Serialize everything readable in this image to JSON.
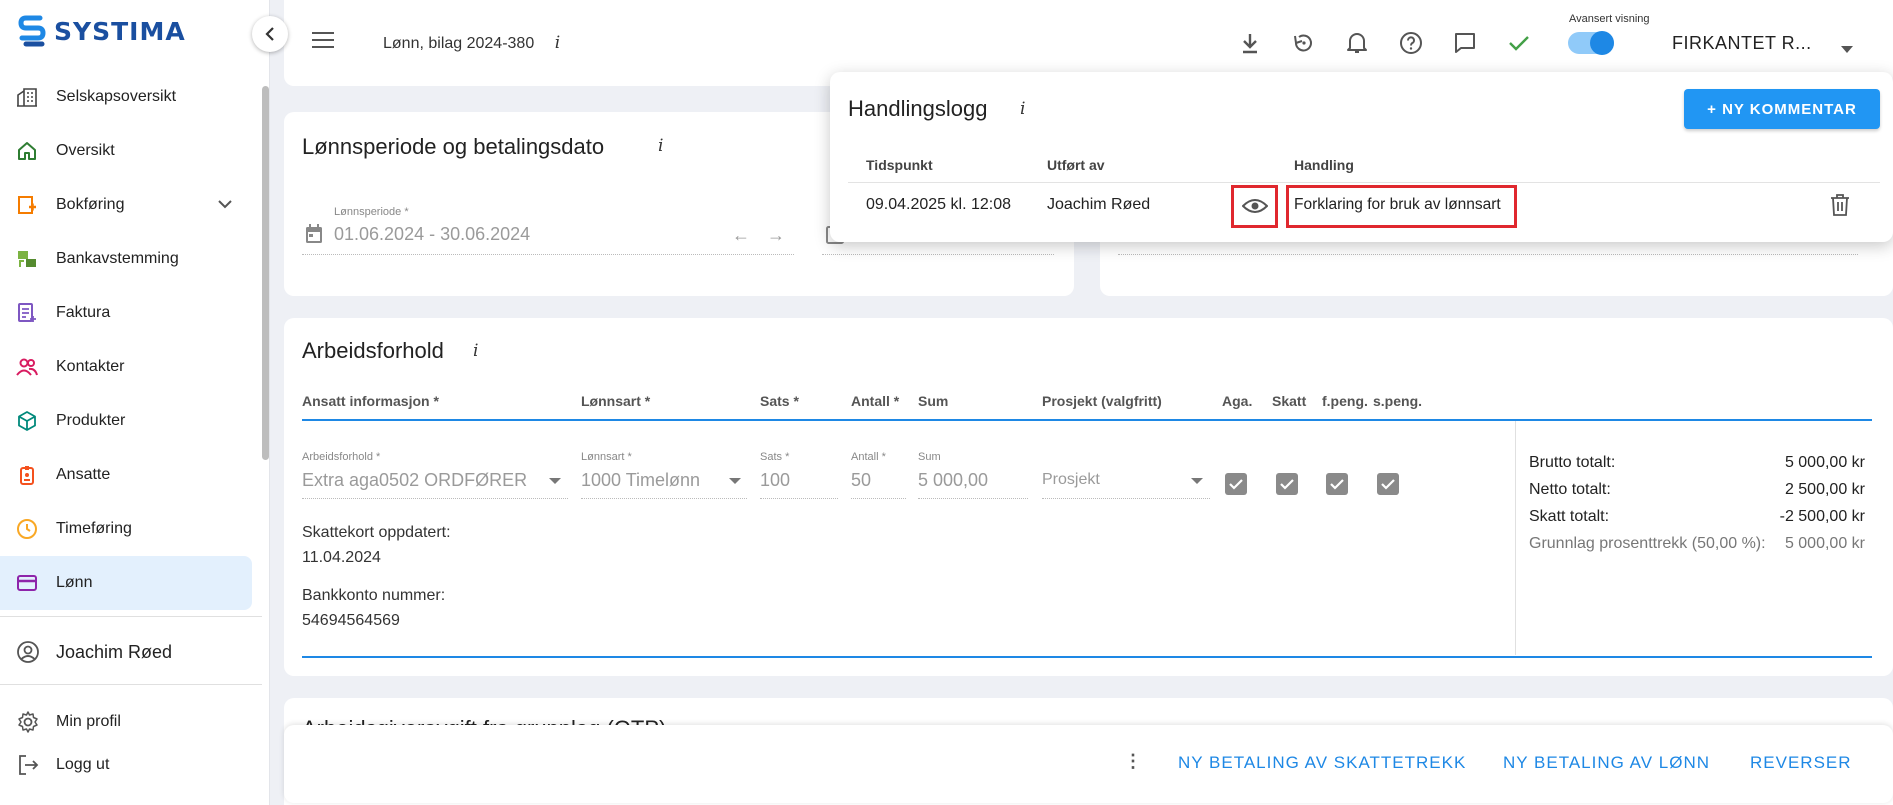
{
  "app": {
    "logo": "SYSTIMA",
    "brand_color": "#1a4fa0",
    "accent": "#1e88e5"
  },
  "sidebar": {
    "items": [
      {
        "label": "Selskapsoversikt",
        "icon": "building-icon"
      },
      {
        "label": "Oversikt",
        "icon": "home-icon"
      },
      {
        "label": "Bokføring",
        "icon": "ledger-icon",
        "has_children": true
      },
      {
        "label": "Bankavstemming",
        "icon": "bank-icon"
      },
      {
        "label": "Faktura",
        "icon": "invoice-icon"
      },
      {
        "label": "Kontakter",
        "icon": "contacts-icon"
      },
      {
        "label": "Produkter",
        "icon": "box-icon"
      },
      {
        "label": "Ansatte",
        "icon": "badge-icon"
      },
      {
        "label": "Timeføring",
        "icon": "clock-icon"
      },
      {
        "label": "Lønn",
        "icon": "card-icon",
        "active": true
      }
    ],
    "user": "Joachim Røed",
    "profile": "Min profil",
    "logout": "Logg ut"
  },
  "topbar": {
    "title": "Lønn, bilag 2024-380",
    "info": "i",
    "advanced_label": "Avansert visning",
    "advanced_on": true,
    "company": "FIRKANTET R..."
  },
  "period_card": {
    "title": "Lønnsperiode og betalingsdato",
    "info": "i",
    "period_label": "Lønnsperiode *",
    "period_value": "01.06.2024 - 30.06.2024"
  },
  "handlingslogg": {
    "title": "Handlingslogg",
    "info": "i",
    "new_comment": "+ NY KOMMENTAR",
    "columns": [
      "Tidspunkt",
      "Utført av",
      "Handling"
    ],
    "rows": [
      {
        "time": "09.04.2025 kl. 12:08",
        "by": "Joachim Røed",
        "action": "Forklaring for bruk av lønnsart"
      }
    ]
  },
  "arbeid": {
    "title": "Arbeidsforhold",
    "info": "i",
    "headers": [
      "Ansatt informasjon *",
      "Lønnsart *",
      "Sats *",
      "Antall *",
      "Sum",
      "Prosjekt (valgfritt)",
      "Aga.",
      "Skatt",
      "f.peng.",
      "s.peng."
    ],
    "fields": {
      "arbeidsforhold_label": "Arbeidsforhold *",
      "arbeidsforhold_value": "Extra aga0502 ORDFØRER",
      "lonnsart_label": "Lønnsart *",
      "lonnsart_value": "1000 Timelønn",
      "sats_label": "Sats *",
      "sats_value": "100",
      "antall_label": "Antall *",
      "antall_value": "50",
      "sum_label": "Sum",
      "sum_value": "5 000,00",
      "prosjekt_placeholder": "Prosjekt"
    },
    "checks": {
      "aga": true,
      "skatt": true,
      "fpeng": true,
      "speng": true
    },
    "skattekort_label": "Skattekort oppdatert:",
    "skattekort_date": "11.04.2024",
    "bank_label": "Bankkonto nummer:",
    "bank_number": "54694564569",
    "totals": [
      {
        "label": "Brutto totalt:",
        "value": "5 000,00 kr"
      },
      {
        "label": "Netto totalt:",
        "value": "2 500,00 kr"
      },
      {
        "label": "Skatt totalt:",
        "value": "-2 500,00 kr"
      },
      {
        "label": "Grunnlag prosenttrekk (50,00 %):",
        "value": "5 000,00 kr",
        "muted": true
      }
    ]
  },
  "peek_section_title": "Arbeidsgiveravgift fra grunnlag (OTP)",
  "footer": {
    "btn1": "NY BETALING AV SKATTETREKK",
    "btn2": "NY BETALING AV LØNN",
    "btn3": "REVERSER"
  }
}
